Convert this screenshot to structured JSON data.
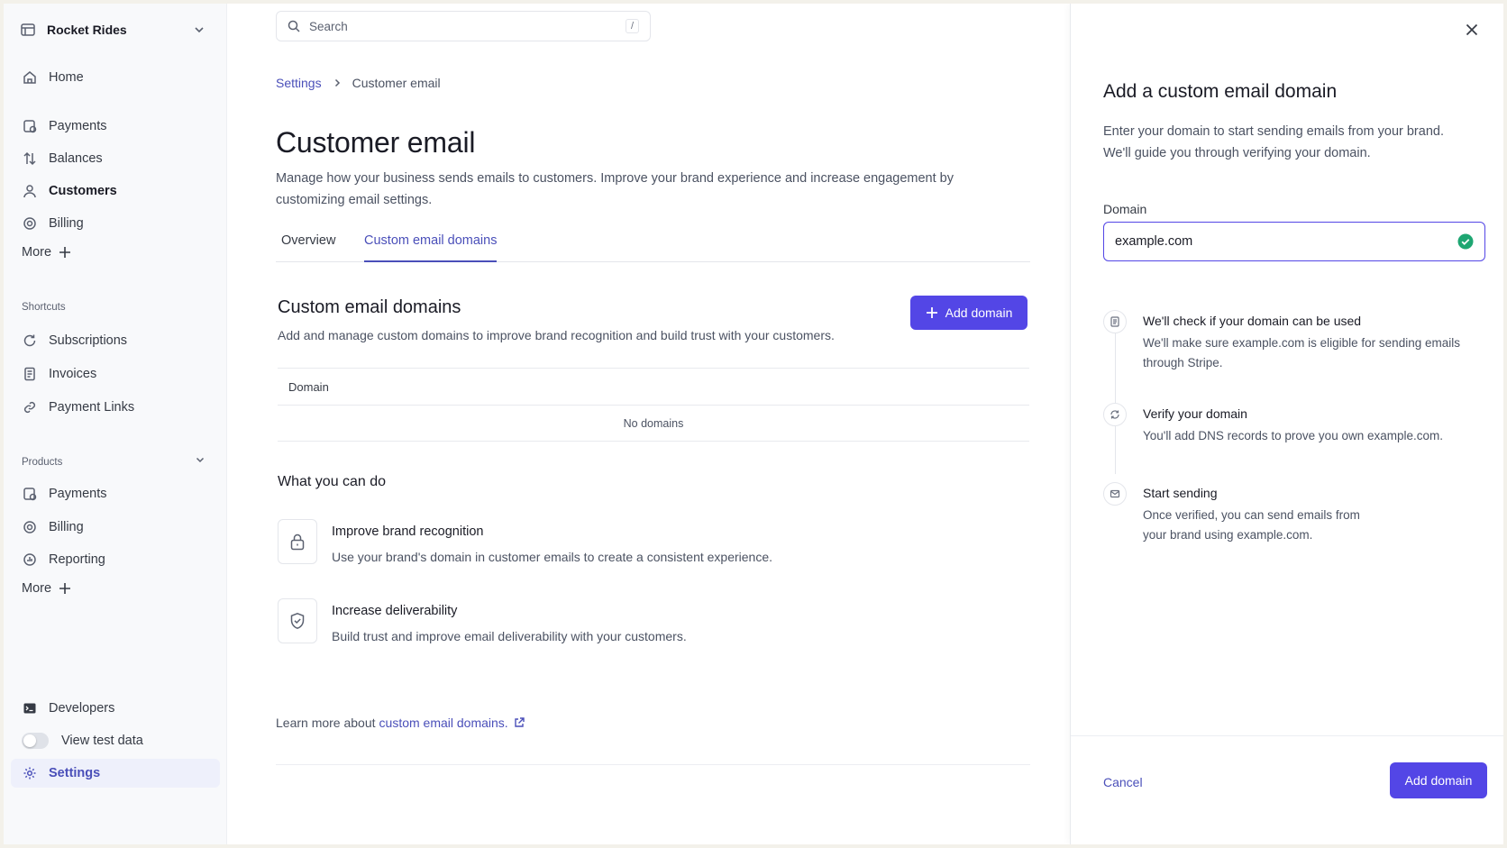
{
  "sidebar": {
    "account_name": "Rocket Rides",
    "items": [
      {
        "label": "Home"
      },
      {
        "label": "Payments"
      },
      {
        "label": "Balances"
      },
      {
        "label": "Customers"
      },
      {
        "label": "Billing"
      }
    ],
    "more_label": "More",
    "shortcuts_label": "Shortcuts",
    "shortcuts": [
      {
        "label": "Subscriptions"
      },
      {
        "label": "Invoices"
      },
      {
        "label": "Payment Links"
      }
    ],
    "products_label": "Products",
    "products": [
      {
        "label": "Payments"
      },
      {
        "label": "Billing"
      },
      {
        "label": "Reporting"
      }
    ],
    "more2_label": "More",
    "developers_label": "Developers",
    "test_data_label": "View test data",
    "settings_label": "Settings"
  },
  "search": {
    "placeholder": "Search",
    "shortcut": "/"
  },
  "breadcrumb": {
    "parent": "Settings",
    "current": "Customer email"
  },
  "page": {
    "title": "Customer email",
    "description": "Manage how your business sends emails to customers. Improve your brand experience and increase engagement by customizing email settings."
  },
  "tabs": [
    {
      "label": "Overview"
    },
    {
      "label": "Custom email domains"
    }
  ],
  "domains_section": {
    "title": "Custom email domains",
    "description": "Add and manage custom domains to improve brand recognition and build trust with your customers.",
    "add_button": "Add domain",
    "table_header": "Domain",
    "empty_text": "No domains"
  },
  "what_you_can_do": {
    "title": "What you can do",
    "features": [
      {
        "title": "Improve brand recognition",
        "description": "Use your brand's domain in customer emails to create a consistent experience."
      },
      {
        "title": "Increase deliverability",
        "description": "Build trust and improve email deliverability with your customers."
      }
    ]
  },
  "learn_more": {
    "prefix": "Learn more about",
    "link": "custom email domains."
  },
  "drawer": {
    "title": "Add a custom email domain",
    "description": "Enter your domain to start sending emails from your brand. We'll guide you through verifying your domain.",
    "domain_label": "Domain",
    "domain_value": "example.com",
    "steps": [
      {
        "title": "We'll check if your domain can be used",
        "description": "We'll make sure example.com is eligible for sending emails through Stripe."
      },
      {
        "title": "Verify your domain",
        "description": "You'll add DNS records to prove you own example.com."
      },
      {
        "title": "Start sending",
        "description": "Once verified, you can send emails from your brand using example.com."
      }
    ],
    "cancel_label": "Cancel",
    "submit_label": "Add domain"
  },
  "colors": {
    "accent": "#5346e6",
    "link": "#4a4fb9",
    "success": "#1ea672"
  }
}
